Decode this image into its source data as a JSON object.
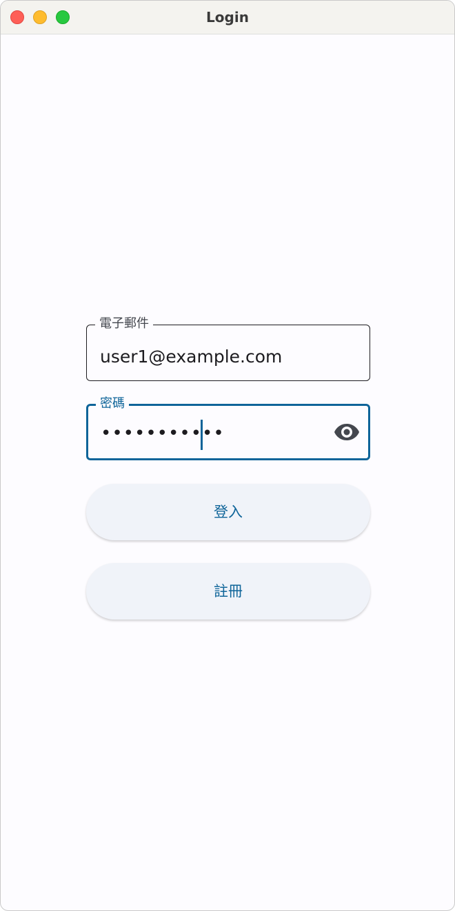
{
  "window": {
    "title": "Login"
  },
  "form": {
    "email": {
      "label": "電子郵件",
      "value": "user1@example.com"
    },
    "password": {
      "label": "密碼",
      "masked_value": "•••••••••••",
      "toggle_icon": "eye-icon"
    },
    "login_label": "登入",
    "register_label": "註冊"
  },
  "colors": {
    "accent": "#0e6499",
    "button_bg": "#f0f3f9",
    "text": "#1c1b1f"
  }
}
